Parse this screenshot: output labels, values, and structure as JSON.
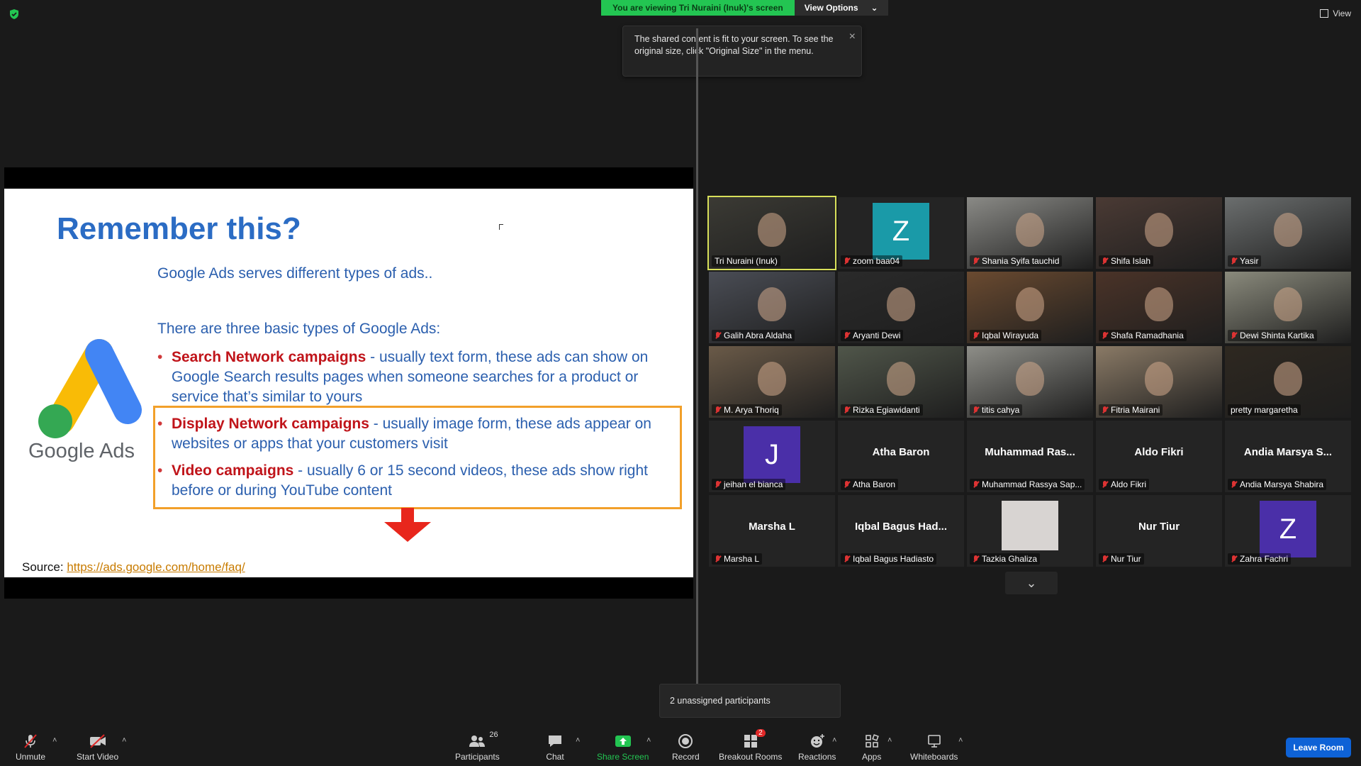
{
  "top": {
    "viewing_text": "You are viewing Tri Nuraini (Inuk)'s screen",
    "view_options": "View Options",
    "view_right": "View"
  },
  "tooltip": {
    "text": "The shared content is fit to your screen. To see the original size, click \"Original Size\" in the menu."
  },
  "slide": {
    "title": "Remember this?",
    "subtitle": "Google Ads serves different types of ads..",
    "intro": "There are three basic types of Google Ads:",
    "bullets": [
      {
        "highlight": "Search Network campaigns",
        "text": " - usually text form, these ads can show on Google Search results pages when someone searches for a product or service that’s similar to yours"
      },
      {
        "highlight": "Display Network campaigns",
        "text": " - usually image form, these ads appear on websites or apps that your customers visit"
      },
      {
        "highlight": "Video campaigns",
        "text": " - usually 6 or 15 second videos, these ads show right before or during YouTube content"
      }
    ],
    "logo_text": "Google Ads",
    "source_label": "Source: ",
    "source_url": "https://ads.google.com/home/faq/"
  },
  "participants": [
    {
      "name": "Tri Nuraini (Inuk)",
      "type": "video",
      "muted": false,
      "color": "#3b3a34"
    },
    {
      "name": "zoom baa04",
      "type": "letter",
      "letter": "Z",
      "letter_bg": "#1a9aa8",
      "muted": true
    },
    {
      "name": "Shania Syifa tauchid",
      "type": "video",
      "muted": true,
      "color": "#8a8a86"
    },
    {
      "name": "Shifa Islah",
      "type": "video",
      "muted": true,
      "color": "#4a3a34"
    },
    {
      "name": "Yasir",
      "type": "video",
      "muted": true,
      "color": "#6b6e6e"
    },
    {
      "name": "Galih Abra Aldaha",
      "type": "video",
      "muted": true,
      "color": "#4a4d55"
    },
    {
      "name": "Aryanti Dewi",
      "type": "video",
      "muted": true,
      "color": "#2a2a2a"
    },
    {
      "name": "Iqbal Wirayuda",
      "type": "video",
      "muted": true,
      "color": "#6a4a30"
    },
    {
      "name": "Shafa Ramadhania",
      "type": "video",
      "muted": true,
      "color": "#4a3328"
    },
    {
      "name": "Dewi Shinta Kartika",
      "type": "video",
      "muted": true,
      "color": "#8a8a7c"
    },
    {
      "name": "M. Arya Thoriq",
      "type": "video",
      "muted": true,
      "color": "#6a5a48"
    },
    {
      "name": "Rizka Egiawidanti",
      "type": "video",
      "muted": true,
      "color": "#50564a"
    },
    {
      "name": "titis cahya",
      "type": "video",
      "muted": true,
      "color": "#8e8e88"
    },
    {
      "name": "Fitria Mairani",
      "type": "video",
      "muted": true,
      "color": "#8a7a66"
    },
    {
      "name": "pretty margaretha",
      "type": "video",
      "muted": false,
      "color": "#2e2820"
    },
    {
      "name": "jeihan el bianca",
      "type": "letter",
      "letter": "J",
      "letter_bg": "#4a2fa8",
      "muted": true
    },
    {
      "name": "Atha Baron",
      "type": "text",
      "big": "Atha Baron",
      "muted": true
    },
    {
      "name": "Muhammad Rassya Sap...",
      "type": "text",
      "big": "Muhammad  Ras...",
      "muted": true
    },
    {
      "name": "Aldo Fikri",
      "type": "text",
      "big": "Aldo Fikri",
      "muted": true
    },
    {
      "name": "Andia Marsya Shabira",
      "type": "text",
      "big": "Andia  Marsya  S...",
      "muted": true
    },
    {
      "name": "Marsha L",
      "type": "text",
      "big": "Marsha L",
      "muted": true
    },
    {
      "name": "Iqbal Bagus Hadiasto",
      "type": "text",
      "big": "Iqbal  Bagus  Had...",
      "muted": true
    },
    {
      "name": "Tazkia Ghaliza",
      "type": "photo",
      "muted": true,
      "color": "#d8d4d2"
    },
    {
      "name": "Nur Tiur",
      "type": "text",
      "big": "Nur Tiur",
      "muted": true
    },
    {
      "name": "Zahra Fachri",
      "type": "letter",
      "letter": "Z",
      "letter_bg": "#4a2fa8",
      "muted": true
    }
  ],
  "unassigned": "2 unassigned participants",
  "toolbar": {
    "unmute": "Unmute",
    "start_video": "Start Video",
    "participants": "Participants",
    "participants_count": "26",
    "chat": "Chat",
    "share_screen": "Share Screen",
    "record": "Record",
    "breakout_rooms": "Breakout Rooms",
    "breakout_badge": "2",
    "reactions": "Reactions",
    "apps": "Apps",
    "whiteboards": "Whiteboards",
    "leave": "Leave Room"
  },
  "colors": {
    "accent_green": "#23c552",
    "leave_blue": "#0e62d6",
    "active_speaker": "#d8e05a",
    "muted_red": "#dd3333"
  }
}
